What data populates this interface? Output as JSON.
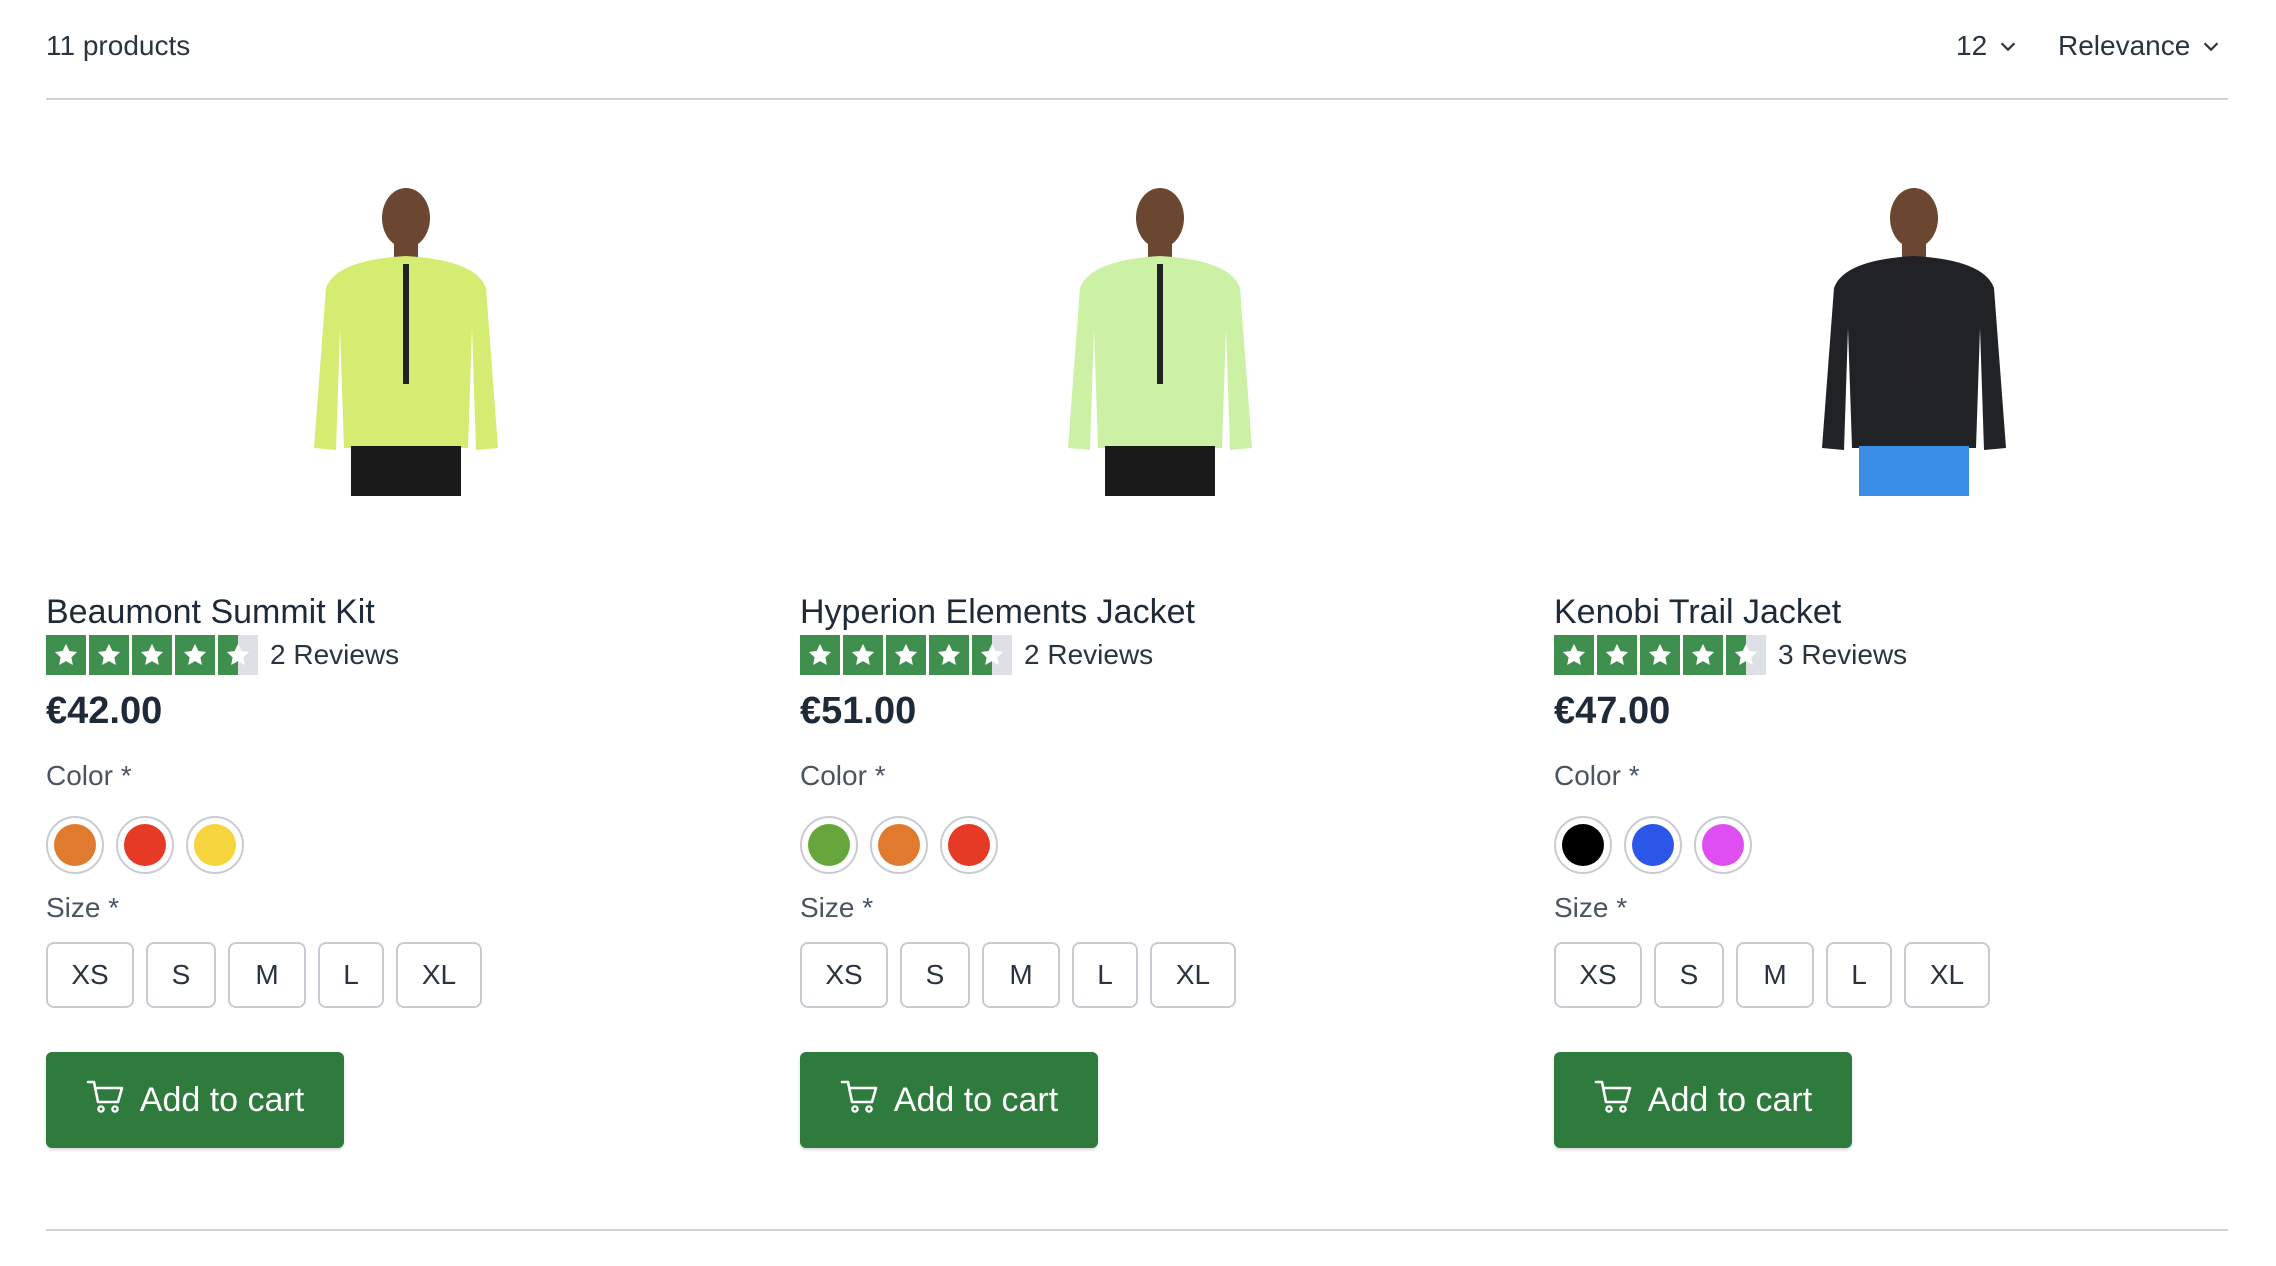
{
  "toolbar": {
    "product_count": "11 products",
    "per_page": "12",
    "sort": "Relevance"
  },
  "colors": {
    "star": "#3f8f4e",
    "button": "#2f7a3d"
  },
  "products": [
    {
      "name": "Beaumont Summit Kit",
      "rating": 4.5,
      "reviews": "2 Reviews",
      "price": "€42.00",
      "color_label": "Color *",
      "colors": [
        "#e07a2e",
        "#e53a25",
        "#f6d43e"
      ],
      "size_label": "Size *",
      "sizes": [
        "XS",
        "S",
        "M",
        "L",
        "XL"
      ],
      "button": "Add to cart",
      "jacket_color": "#d4ec72"
    },
    {
      "name": "Hyperion Elements Jacket",
      "rating": 4.5,
      "reviews": "2 Reviews",
      "price": "€51.00",
      "color_label": "Color *",
      "colors": [
        "#66a63b",
        "#e07a2e",
        "#e53a25"
      ],
      "size_label": "Size *",
      "sizes": [
        "XS",
        "S",
        "M",
        "L",
        "XL"
      ],
      "button": "Add to cart",
      "jacket_color": "#ccf0a4"
    },
    {
      "name": "Kenobi Trail Jacket",
      "rating": 4.5,
      "reviews": "3 Reviews",
      "price": "€47.00",
      "color_label": "Color *",
      "colors": [
        "#000000",
        "#2c56e8",
        "#de4ef0"
      ],
      "size_label": "Size *",
      "sizes": [
        "XS",
        "S",
        "M",
        "L",
        "XL"
      ],
      "button": "Add to cart",
      "jacket_color": "#202225"
    }
  ]
}
